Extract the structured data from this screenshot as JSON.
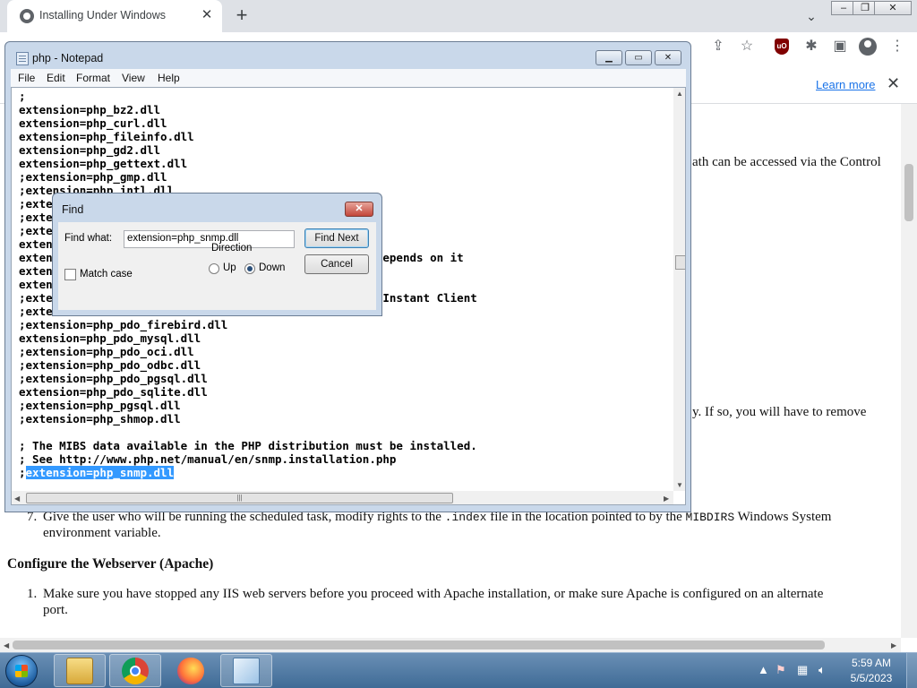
{
  "browser": {
    "tab": {
      "title": "Installing Under Windows",
      "icon": "globe-icon"
    },
    "new_tab_label": "+",
    "info_bar": {
      "learn_more": "Learn more"
    },
    "toolbar_icons": [
      "share-icon",
      "star-icon",
      "ublock-icon",
      "extensions-icon",
      "sidepanel-icon",
      "profile-icon",
      "menu-icon"
    ]
  },
  "page": {
    "line_right_top": "ath can be accessed via the Control",
    "line_right_mid": "y. If so, you will have to remove",
    "item7_num": "7.",
    "item7_a": "Give the user who will be running the scheduled task, modify rights to the",
    "item7_code1": ".index",
    "item7_b": "file in the location pointed to by the",
    "item7_code2": "MIBDIRS",
    "item7_c": "Windows System",
    "item7_line2": "environment variable.",
    "heading": "Configure the Webserver (Apache)",
    "item1_num": "1.",
    "item1_line1": "Make sure you have stopped any IIS web servers before you proceed with Apache installation, or make sure Apache is configured on an alternate",
    "item1_line2": "port."
  },
  "notepad": {
    "title": "php - Notepad",
    "menu": [
      "File",
      "Edit",
      "Format",
      "View",
      "Help"
    ],
    "lines": [
      ";",
      "extension=php_bz2.dll",
      "extension=php_curl.dll",
      "extension=php_fileinfo.dll",
      "extension=php_gd2.dll",
      "extension=php_gettext.dll",
      ";extension=php_gmp.dll",
      ";extension=php_intl.dll",
      ";exte",
      ";exte",
      ";exte",
      "exten",
      "exten                                        g as it depends on it",
      "exten",
      "exten",
      ";exte                                        base 12c Instant Client",
      ";exte",
      ";extension=php_pdo_firebird.dll",
      "extension=php_pdo_mysql.dll",
      ";extension=php_pdo_oci.dll",
      ";extension=php_pdo_odbc.dll",
      ";extension=php_pdo_pgsql.dll",
      "extension=php_pdo_sqlite.dll",
      ";extension=php_pgsql.dll",
      ";extension=php_shmop.dll",
      "",
      "; The MIBS data available in the PHP distribution must be installed.",
      "; See http://www.php.net/manual/en/snmp.installation.php"
    ],
    "last_line_prefix": ";",
    "last_line_selected": "extension=php_snmp.dll"
  },
  "find_dialog": {
    "title": "Find",
    "find_what_label": "Find what:",
    "find_what_value": "extension=php_snmp.dll",
    "find_next": "Find Next",
    "cancel": "Cancel",
    "direction_label": "Direction",
    "up_label": "Up",
    "down_label": "Down",
    "selected_direction": "Down",
    "match_case_label": "Match case",
    "match_case_checked": false
  },
  "taskbar": {
    "apps": [
      "file-explorer-icon",
      "chrome-icon",
      "firefox-icon",
      "notepad-icon"
    ],
    "time": "5:59 AM",
    "date": "5/5/2023"
  },
  "colors": {
    "selection": "#3399ff",
    "link": "#1a73e8",
    "taskbar": "#4f7aa5"
  }
}
